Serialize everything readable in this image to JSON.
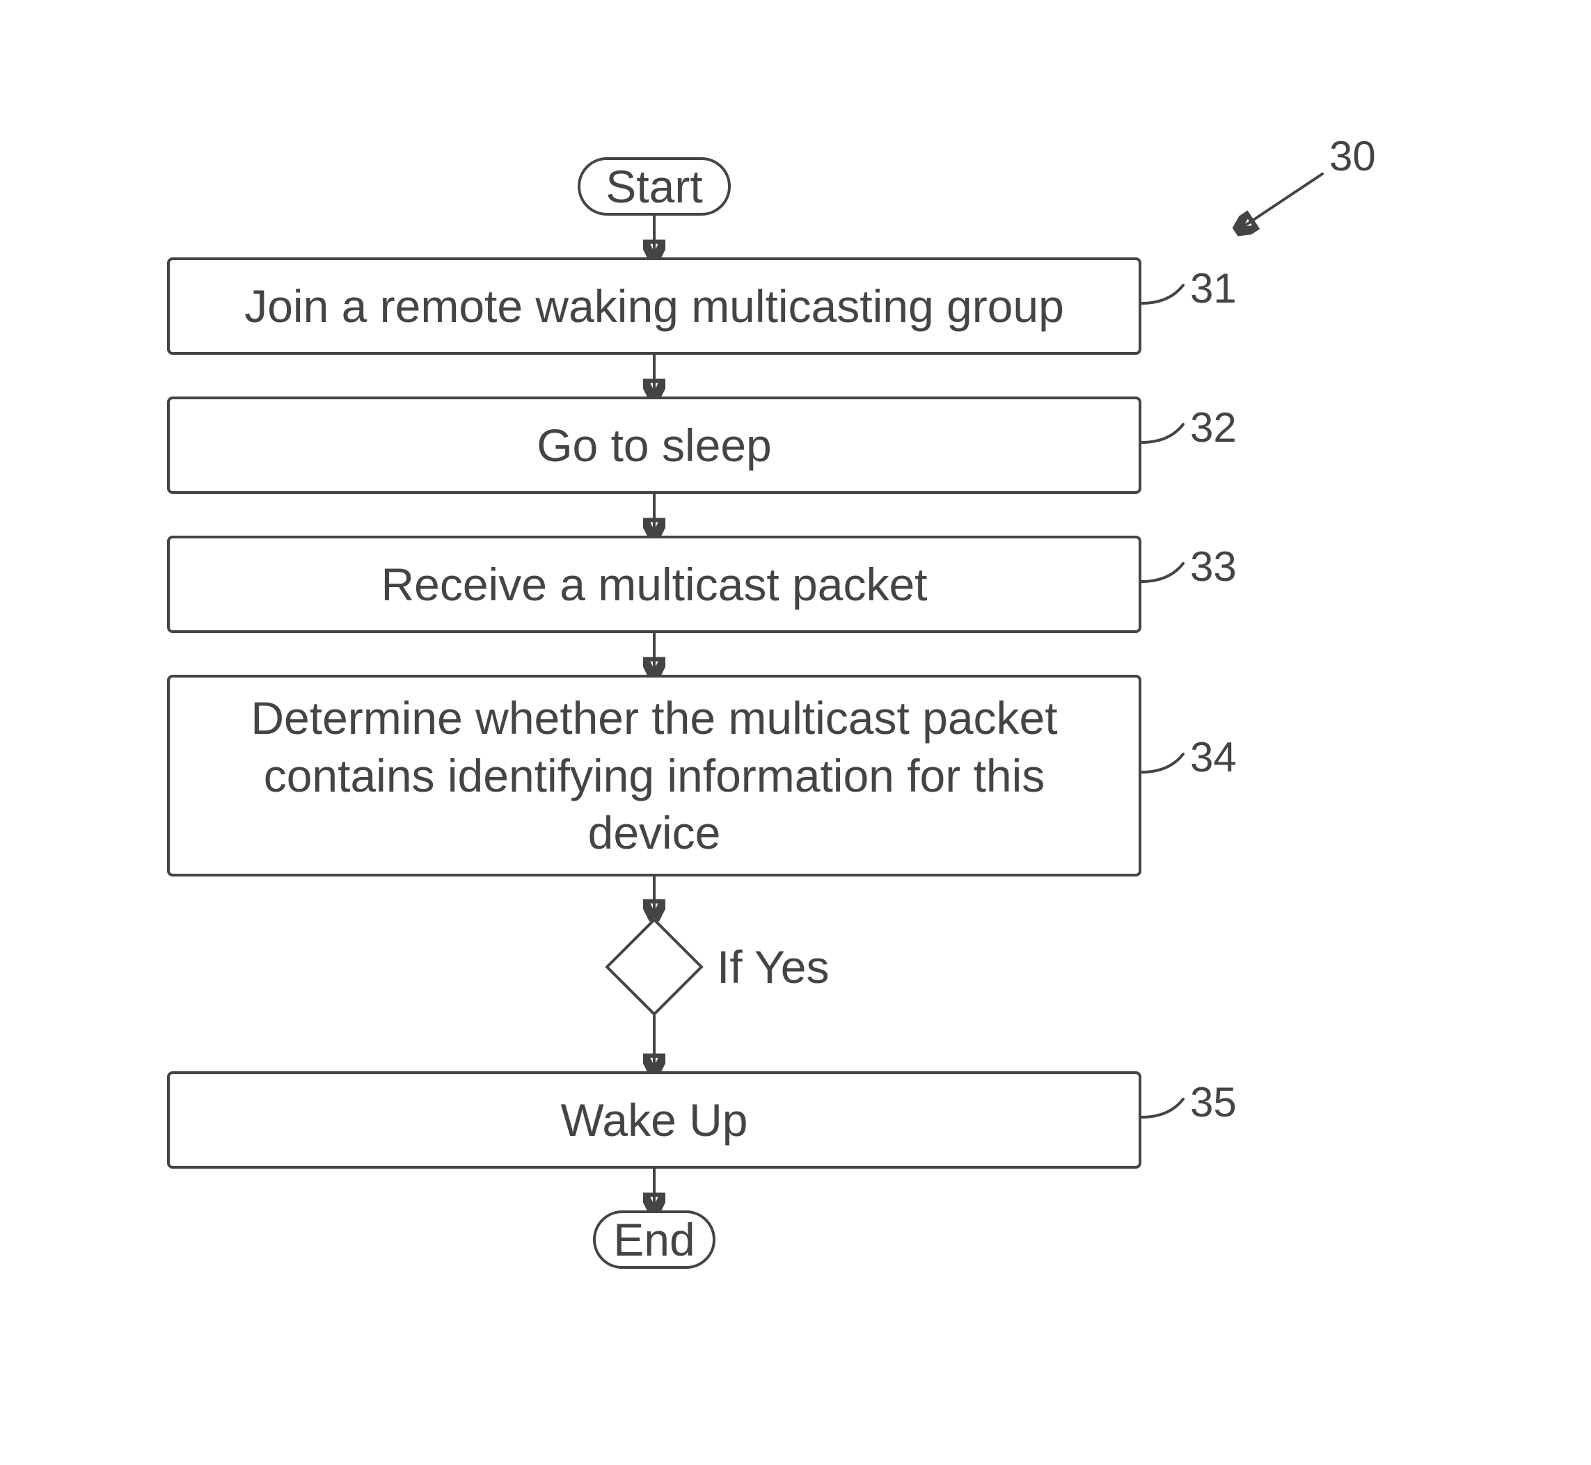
{
  "chart_data": {
    "type": "flowchart",
    "title": "",
    "reference_number_diagram": "30",
    "nodes": [
      {
        "id": "start",
        "shape": "terminator",
        "label": "Start",
        "ref": ""
      },
      {
        "id": "n31",
        "shape": "process",
        "label": "Join a remote waking multicasting group",
        "ref": "31"
      },
      {
        "id": "n32",
        "shape": "process",
        "label": "Go to sleep",
        "ref": "32"
      },
      {
        "id": "n33",
        "shape": "process",
        "label": "Receive a multicast packet",
        "ref": "33"
      },
      {
        "id": "n34",
        "shape": "process",
        "label": "Determine whether the multicast packet contains identifying information for this device",
        "ref": "34"
      },
      {
        "id": "dec",
        "shape": "decision",
        "label": "",
        "ref": "",
        "branch_label": "If Yes"
      },
      {
        "id": "n35",
        "shape": "process",
        "label": "Wake Up",
        "ref": "35"
      },
      {
        "id": "end",
        "shape": "terminator",
        "label": "End",
        "ref": ""
      }
    ],
    "edges": [
      {
        "from": "start",
        "to": "n31",
        "label": ""
      },
      {
        "from": "n31",
        "to": "n32",
        "label": ""
      },
      {
        "from": "n32",
        "to": "n33",
        "label": ""
      },
      {
        "from": "n33",
        "to": "n34",
        "label": ""
      },
      {
        "from": "n34",
        "to": "dec",
        "label": ""
      },
      {
        "from": "dec",
        "to": "n35",
        "label": "If Yes"
      },
      {
        "from": "n35",
        "to": "end",
        "label": ""
      }
    ]
  }
}
